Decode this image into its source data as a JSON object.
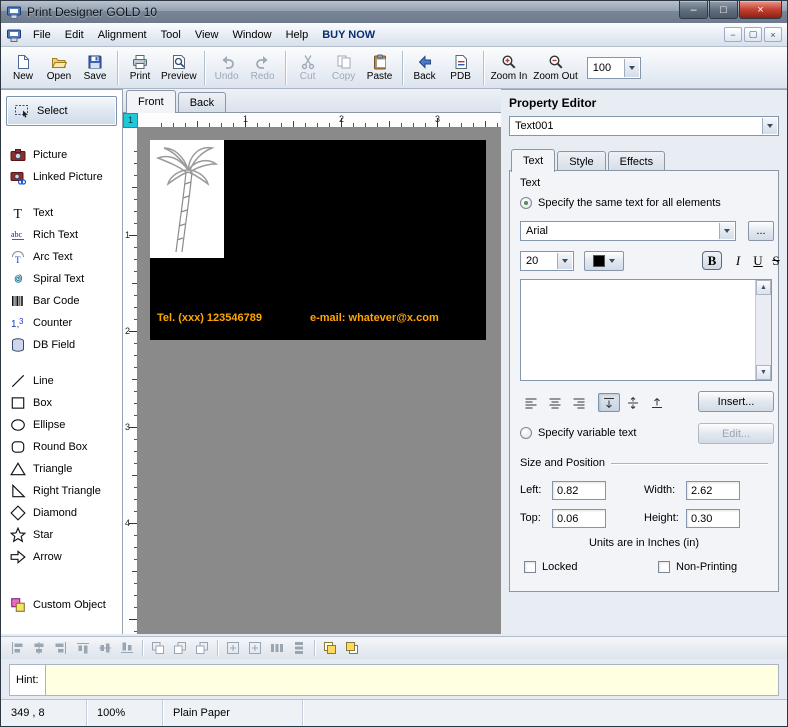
{
  "window": {
    "title": "Print Designer GOLD 10"
  },
  "menu": {
    "items": [
      "File",
      "Edit",
      "Alignment",
      "Tool",
      "View",
      "Window",
      "Help",
      "BUY NOW"
    ]
  },
  "toolbar": {
    "buttons": [
      {
        "label": "New",
        "icon": "new-document-icon"
      },
      {
        "label": "Open",
        "icon": "open-folder-icon"
      },
      {
        "label": "Save",
        "icon": "save-floppy-icon"
      },
      {
        "label": "Print",
        "icon": "printer-icon"
      },
      {
        "label": "Preview",
        "icon": "print-preview-icon"
      },
      {
        "label": "Undo",
        "icon": "undo-arrow-icon",
        "disabled": true
      },
      {
        "label": "Redo",
        "icon": "redo-arrow-icon",
        "disabled": true
      },
      {
        "label": "Cut",
        "icon": "scissors-icon",
        "disabled": true
      },
      {
        "label": "Copy",
        "icon": "copy-pages-icon",
        "disabled": true
      },
      {
        "label": "Paste",
        "icon": "clipboard-icon"
      },
      {
        "label": "Back",
        "icon": "back-arrow-icon"
      },
      {
        "label": "PDB",
        "icon": "pdb-document-icon"
      },
      {
        "label": "Zoom In",
        "icon": "zoom-in-icon"
      },
      {
        "label": "Zoom Out",
        "icon": "zoom-out-icon"
      }
    ],
    "zoom_value": "100"
  },
  "sidebar": {
    "select_label": "Select",
    "tools": [
      {
        "label": "Picture",
        "icon": "camera-icon"
      },
      {
        "label": "Linked Picture",
        "icon": "linked-camera-icon"
      },
      {
        "label": "Text",
        "icon": "text-t-icon"
      },
      {
        "label": "Rich Text",
        "icon": "rich-text-icon"
      },
      {
        "label": "Arc Text",
        "icon": "arc-text-icon"
      },
      {
        "label": "Spiral Text",
        "icon": "spiral-text-icon"
      },
      {
        "label": "Bar Code",
        "icon": "barcode-icon"
      },
      {
        "label": "Counter",
        "icon": "counter-icon"
      },
      {
        "label": "DB Field",
        "icon": "database-icon"
      },
      {
        "label": "Line",
        "icon": "line-icon"
      },
      {
        "label": "Box",
        "icon": "box-icon"
      },
      {
        "label": "Ellipse",
        "icon": "ellipse-icon"
      },
      {
        "label": "Round Box",
        "icon": "round-box-icon"
      },
      {
        "label": "Triangle",
        "icon": "triangle-icon"
      },
      {
        "label": "Right Triangle",
        "icon": "right-triangle-icon"
      },
      {
        "label": "Diamond",
        "icon": "diamond-icon"
      },
      {
        "label": "Star",
        "icon": "star-icon"
      },
      {
        "label": "Arrow",
        "icon": "arrow-icon"
      },
      {
        "label": "Custom Object",
        "icon": "custom-object-icon"
      }
    ]
  },
  "canvas": {
    "tabs": [
      "Front",
      "Back"
    ],
    "active_tab": "Front",
    "page_indicator": "1",
    "hruler_numbers": [
      "1",
      "2",
      "3"
    ],
    "vruler_numbers": [
      "1",
      "2",
      "3",
      "4"
    ],
    "card": {
      "tel": "Tel. (xxx) 123546789",
      "email": "e-mail: whatever@x.com"
    }
  },
  "property_editor": {
    "title": "Property Editor",
    "selected_element": "Text001",
    "tabs": [
      "Text",
      "Style",
      "Effects"
    ],
    "text_tab": {
      "group_label": "Text",
      "same_text_option": "Specify the same text for all elements",
      "font_name": "Arial",
      "font_browse": "...",
      "font_size": "20",
      "bold": "B",
      "italic": "I",
      "underline": "U",
      "strike": "S",
      "text_value": "",
      "insert_button": "Insert...",
      "variable_text_option": "Specify variable text",
      "edit_button": "Edit..."
    },
    "size_position": {
      "group_label": "Size and Position",
      "left_label": "Left:",
      "left": "0.82",
      "width_label": "Width:",
      "width": "2.62",
      "top_label": "Top:",
      "top": "0.06",
      "height_label": "Height:",
      "height": "0.30",
      "units": "Units are in Inches (in)",
      "locked": "Locked",
      "non_printing": "Non-Printing"
    }
  },
  "hint": {
    "label": "Hint:",
    "text": ""
  },
  "statusbar": {
    "position": "349 , 8",
    "zoom": "100%",
    "paper": "Plain Paper"
  },
  "colors": {
    "card_background": "#000000",
    "card_text": "#FFA500",
    "hint_field": "#FFFFE1",
    "page_indicator_bg": "#1FC8D8",
    "buy_now_text": "#0B2E6E"
  }
}
